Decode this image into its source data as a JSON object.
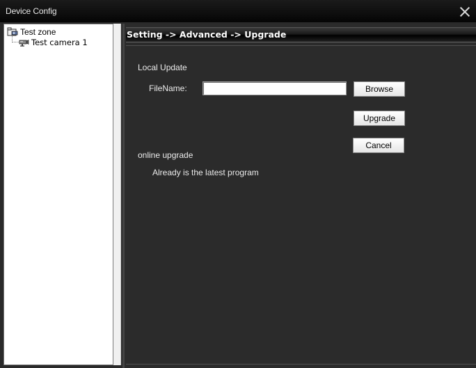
{
  "window": {
    "title": "Device Config"
  },
  "tree": {
    "root_label": "Test zone",
    "child_label": "Test camera 1"
  },
  "header": {
    "breadcrumb": "Setting -> Advanced -> Upgrade"
  },
  "local_update": {
    "section_label": "Local Update",
    "filename_label": "FileName:",
    "filename_value": "",
    "browse_label": "Browse",
    "upgrade_label": "Upgrade",
    "cancel_label": "Cancel"
  },
  "online_upgrade": {
    "section_label": "online upgrade",
    "status": "Already is the latest program"
  },
  "icons": {
    "close": "close-icon",
    "zone": "zone-folder-icon",
    "camera": "camera-icon"
  }
}
